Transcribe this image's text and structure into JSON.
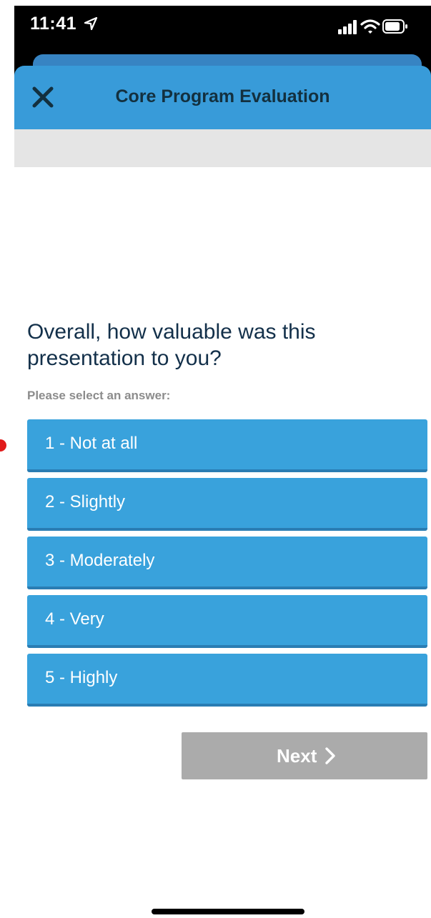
{
  "status_bar": {
    "time": "11:41",
    "icons": [
      "location-arrow-icon",
      "signal-icon",
      "wifi-icon",
      "battery-icon"
    ]
  },
  "header": {
    "title": "Core Program Evaluation",
    "close_icon": "close-icon"
  },
  "survey": {
    "question": "Overall, how valuable was this presentation to you?",
    "prompt": "Please select an answer:",
    "options": [
      {
        "label": "1 - Not at all"
      },
      {
        "label": "2 - Slightly"
      },
      {
        "label": "3 - Moderately"
      },
      {
        "label": "4 - Very"
      },
      {
        "label": "5 - Highly"
      }
    ]
  },
  "footer": {
    "next_label": "Next",
    "next_icon": "chevron-right-icon"
  },
  "colors": {
    "header_blue": "#389bd9",
    "option_blue": "#39a2dc",
    "option_border": "#2a7db3",
    "title_text": "#13303f",
    "question_text": "#13304a",
    "prompt_text": "#8c8c8c",
    "disabled_button": "#ababab",
    "band_gray": "#e5e5e5",
    "marker_red": "#e11b1b"
  }
}
